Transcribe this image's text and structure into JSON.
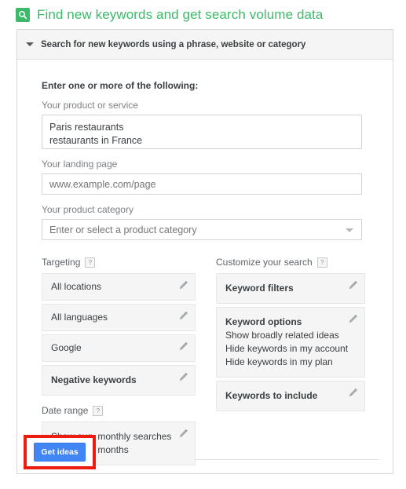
{
  "page": {
    "title": "Find new keywords and get search volume data",
    "title_icon": "search-icon",
    "accent_green": "#3cba6a"
  },
  "panel": {
    "header_label": "Search for new keywords using a phrase, website or category",
    "caret_icon": "chevron-down-icon",
    "expanded": true
  },
  "form": {
    "heading": "Enter one or more of the following:",
    "product_or_service": {
      "label": "Your product or service",
      "value": "Paris restaurants\nrestaurants in France"
    },
    "landing_page": {
      "label": "Your landing page",
      "placeholder": "www.example.com/page",
      "value": ""
    },
    "product_category": {
      "label": "Your product category",
      "placeholder": "Enter or select a product category",
      "value": "",
      "caret_icon": "chevron-down-icon"
    }
  },
  "targeting": {
    "heading": "Targeting",
    "help_icon": "?",
    "items": [
      {
        "label": "All locations",
        "bold": false,
        "edit_icon": "pencil-icon"
      },
      {
        "label": "All languages",
        "bold": false,
        "edit_icon": "pencil-icon"
      },
      {
        "label": "Google",
        "bold": false,
        "edit_icon": "pencil-icon"
      },
      {
        "label": "Negative keywords",
        "bold": true,
        "edit_icon": "pencil-icon"
      }
    ]
  },
  "date_range": {
    "heading": "Date range",
    "help_icon": "?",
    "line1": "Show avg. monthly searches",
    "line2": "for: last 12 months",
    "edit_icon": "pencil-icon"
  },
  "customize": {
    "heading": "Customize your search",
    "help_icon": "?",
    "keyword_filters": {
      "title": "Keyword filters",
      "edit_icon": "pencil-icon"
    },
    "keyword_options": {
      "title": "Keyword options",
      "edit_icon": "pencil-icon",
      "lines": [
        "Show broadly related ideas",
        "Hide keywords in my account",
        "Hide keywords in my plan"
      ]
    },
    "keywords_to_include": {
      "title": "Keywords to include",
      "edit_icon": "pencil-icon"
    }
  },
  "actions": {
    "get_ideas_label": "Get ideas",
    "get_ideas_color": "#4285f4",
    "highlight_color": "#ec1c0e"
  }
}
